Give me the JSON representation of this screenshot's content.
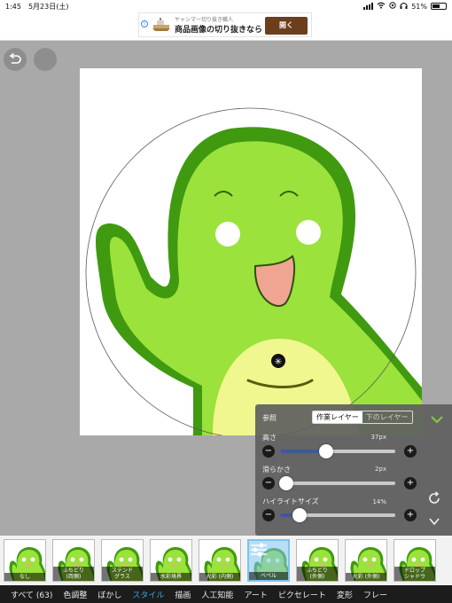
{
  "status_bar": {
    "time": "1:45",
    "date": "5月23日(土)",
    "battery": "51%"
  },
  "ad": {
    "info_glyph": "i",
    "subtext": "ヤャンマー切り抜き職人",
    "headline": "商品画像の切り抜きなら",
    "button": "開く"
  },
  "toolbar": {
    "undo_icon": "undo-arrow-icon",
    "redo_icon": "redo-icon"
  },
  "panel": {
    "reference_label": "参照",
    "segment_options": [
      "作業レイヤー",
      "下のレイヤー"
    ],
    "segment_selected": "作業レイヤー",
    "confirm_icon": "checkmark-chevron-icon",
    "height": {
      "label": "高さ",
      "value": "37px",
      "level": 0.37
    },
    "smoothness": {
      "label": "滑らかさ",
      "value": "2px",
      "level": 0.02
    },
    "highlight": {
      "label": "ハイライトサイズ",
      "value": "14%",
      "level": 0.14
    },
    "minus_glyph": "−",
    "plus_glyph": "+",
    "reset_icon": "reset-icon",
    "collapse_icon": "chevron-down-icon"
  },
  "thumbnails": [
    {
      "label": "なし"
    },
    {
      "label": "ふちどり\n(両側)"
    },
    {
      "label": "ステンド\nグラス"
    },
    {
      "label": "水彩境界"
    },
    {
      "label": "光彩 (内側)"
    },
    {
      "label": "ベベル",
      "selected": true
    },
    {
      "label": "ふちどり\n(外側)"
    },
    {
      "label": "光彩 (外側)"
    },
    {
      "label": "ドロップ\nシャドウ"
    }
  ],
  "categories": [
    {
      "label": "すべて (63)"
    },
    {
      "label": "色調整"
    },
    {
      "label": "ぼかし"
    },
    {
      "label": "スタイル",
      "active": true
    },
    {
      "label": "描画"
    },
    {
      "label": "人工知能"
    },
    {
      "label": "アート"
    },
    {
      "label": "ピクセレート"
    },
    {
      "label": "変形"
    },
    {
      "label": "フレー"
    }
  ],
  "colors": {
    "accent": "#3aa3e8",
    "character_outline": "#3f9a10",
    "character_body": "#9be23c",
    "belly": "#f1f78f",
    "mouth": "#f0a593"
  }
}
